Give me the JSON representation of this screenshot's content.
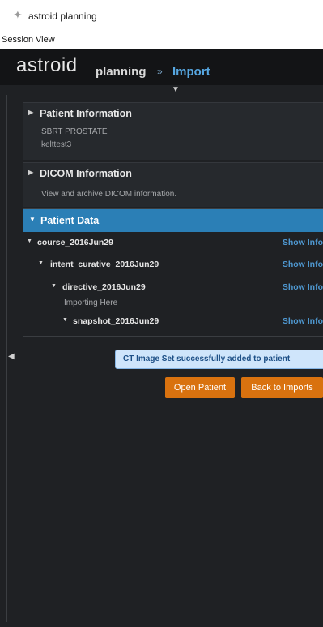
{
  "window": {
    "title": "astroid planning"
  },
  "menu": {
    "items": [
      "Session",
      "View"
    ]
  },
  "header": {
    "brand": "astroid",
    "crumb_planning": "planning",
    "crumb_sep": "»",
    "crumb_current": "Import"
  },
  "sections": {
    "patient_info": {
      "title": "Patient Information",
      "line1": "SBRT PROSTATE",
      "line2": "kelttest3"
    },
    "dicom_info": {
      "title": "DICOM Information",
      "line1": "View and archive DICOM information."
    },
    "patient_data": {
      "title": "Patient Data"
    }
  },
  "tree": [
    {
      "label": "course_2016Jun29",
      "action": "Show Info"
    },
    {
      "label": "intent_curative_2016Jun29",
      "action": "Show Info"
    },
    {
      "label": "directive_2016Jun29",
      "action": "Show Info"
    },
    {
      "label": "snapshot_2016Jun29",
      "action": "Show Info"
    }
  ],
  "tree_note": "Importing Here",
  "status": {
    "message": "CT Image Set successfully added to patient"
  },
  "buttons": {
    "open_patient": "Open Patient",
    "back_to_imports": "Back to Imports"
  },
  "icons": {
    "app": "app-icon",
    "collapse": "chevron-down-icon",
    "rail_toggle": "chevron-left-icon"
  },
  "colors": {
    "accent": "#2b7fb6",
    "link": "#4f99d2",
    "button": "#d9720f",
    "status_bg": "#cfe5fb"
  }
}
